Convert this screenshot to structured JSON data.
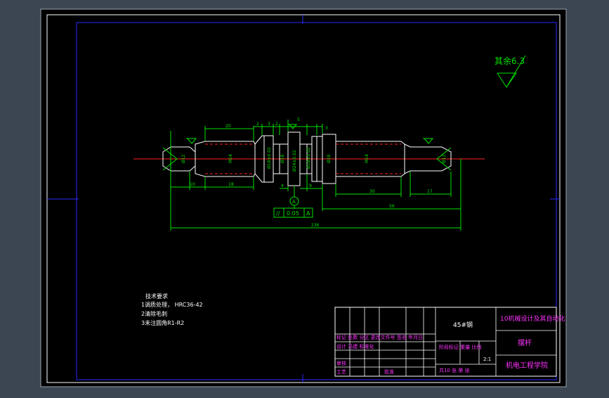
{
  "roughness_note": "其余6.3",
  "dimensions": {
    "d20": "20",
    "d2a": "2",
    "d3a": "3",
    "d2b": "2",
    "d5": "5",
    "d3b": "3",
    "d10": "10",
    "d18": "18",
    "d4": "4",
    "d9": "9",
    "d30": "30",
    "d17": "17",
    "d56": "56",
    "d236": "236"
  },
  "diameters": {
    "left_end": "Ø12",
    "left_shaft": "M14",
    "m1": "Ø18±0.02",
    "m2": "Ø18",
    "m3": "Ø24±0.02",
    "m4": "Ø18±0.02",
    "m5": "Ø18",
    "right_shaft": "M14",
    "right_end": "Ø12"
  },
  "datum_label": "A",
  "tolerance": {
    "symbol": "//",
    "value": "0.05",
    "datum": "A"
  },
  "tech_requirements": {
    "title": "技术要求",
    "line1": "1调质处理， HRC36-42",
    "line2": "2清除毛刺",
    "line3": "3未注圆角R1-R2"
  },
  "title_block": {
    "material": "45#钢",
    "course_title": "10机械设计及其自动化",
    "part_name": "摆杆",
    "school": "机电工程学院",
    "change_row": "标记 处数 分区 更改文件号 签名 年月日",
    "design_row": "设计 冯建 标准化",
    "stage_labels": "阶段标记 重量 比例",
    "scale": "2:1",
    "review": "审核",
    "craft": "工艺",
    "approve": "批准",
    "sheets": "共10 张  第  张"
  }
}
